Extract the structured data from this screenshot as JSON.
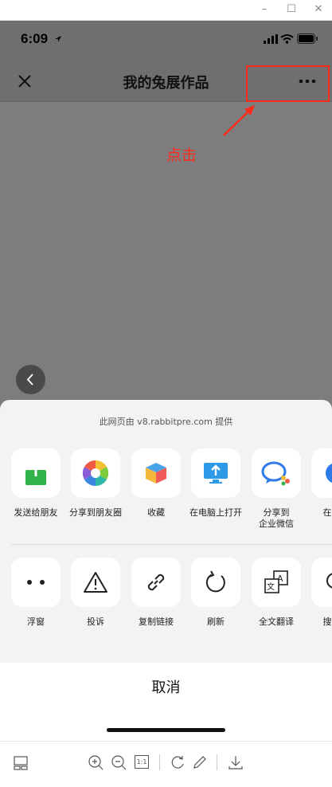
{
  "status": {
    "time": "6:09"
  },
  "nav": {
    "title": "我的兔展作品"
  },
  "annotation": {
    "text": "点击",
    "color": "#ff2a1a"
  },
  "sheet": {
    "provider": "此网页由 v8.rabbitpre.com 提供",
    "row1": [
      {
        "label": "发送给朋友",
        "icon": "send-to-friend-icon"
      },
      {
        "label": "分享到朋友圈",
        "icon": "moments-icon"
      },
      {
        "label": "收藏",
        "icon": "favorite-cube-icon"
      },
      {
        "label": "在电脑上打开",
        "icon": "open-on-pc-icon"
      },
      {
        "label": "分享到\n企业微信",
        "icon": "wecom-icon"
      },
      {
        "label": "在默认\n中",
        "icon": "default-browser-icon"
      }
    ],
    "row2": [
      {
        "label": "浮窗",
        "icon": "float-window-icon"
      },
      {
        "label": "投诉",
        "icon": "warning-icon"
      },
      {
        "label": "复制链接",
        "icon": "link-icon"
      },
      {
        "label": "刷新",
        "icon": "refresh-icon"
      },
      {
        "label": "全文翻译",
        "icon": "translate-icon"
      },
      {
        "label": "搜索页",
        "icon": "search-page-icon"
      }
    ],
    "cancel": "取消"
  },
  "toolbar": {
    "icons": [
      "layout-icon",
      "zoom-in-icon",
      "zoom-out-icon",
      "actual-size-icon",
      "rotate-icon",
      "edit-icon",
      "download-icon"
    ],
    "actual_size": "1:1"
  }
}
